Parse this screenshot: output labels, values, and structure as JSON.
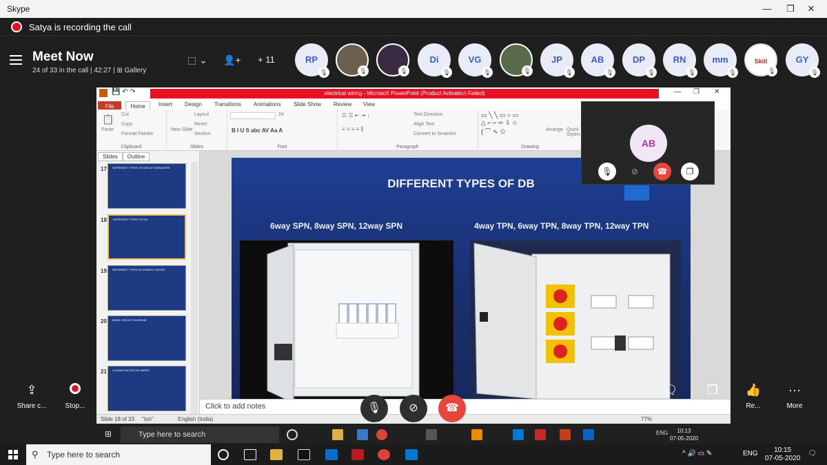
{
  "window": {
    "title": "Skype",
    "minimize": "—",
    "maximize": "❐",
    "close": "✕"
  },
  "recording": {
    "text": "Satya is recording the call"
  },
  "call": {
    "title": "Meet Now",
    "subtitle": "24 of 33 in the call | 42:27 | ⊞ Gallery",
    "more_count": "+ 11",
    "participants": [
      "RP",
      "",
      "",
      "Di",
      "VG",
      "",
      "JP",
      "AB",
      "DP",
      "RN",
      "mm",
      "Skill",
      "GY"
    ]
  },
  "ppt": {
    "title": "electrical wiring - Microsoft PowerPoint (Product Activation Failed)",
    "tabs": [
      "Home",
      "Insert",
      "Design",
      "Transitions",
      "Animations",
      "Slide Show",
      "Review",
      "View"
    ],
    "file_tab": "File",
    "ribbon": {
      "paste": "Paste",
      "cut": "Cut",
      "copy": "Copy",
      "format_painter": "Format Painter",
      "clipboard": "Clipboard",
      "new_slide": "New Slide",
      "layout": "Layout",
      "reset": "Reset",
      "section": "Section",
      "slides": "Slides",
      "font_size": "24",
      "font": "Font",
      "paragraph": "Paragraph",
      "text_direction": "Text Direction",
      "align_text": "Align Text",
      "convert_smartart": "Convert to SmartArt",
      "drawing": "Drawing",
      "arrange": "Arrange",
      "quick_styles": "Quick Styles"
    },
    "pane_tabs": [
      "Slides",
      "Outline"
    ],
    "thumbnails": [
      {
        "num": "17",
        "title": "DIFFERENT TYPES OF CIRCUIT BREAKERS"
      },
      {
        "num": "18",
        "title": "DIFFERENT TYPES OF DB"
      },
      {
        "num": "19",
        "title": "DIFFERENT TYPES OF ENERGY METER"
      },
      {
        "num": "20",
        "title": "BASIC CIRCUIT DIAGRAM"
      },
      {
        "num": "21",
        "title": "CLASSIFICATION OF WIRES"
      }
    ],
    "slide": {
      "title": "DIFFERENT TYPES OF DB",
      "left_caption": "6way SPN, 8way SPN, 12way SPN",
      "right_caption": "4way TPN, 6way TPN, 8way TPN, 12way TPN"
    },
    "notes_placeholder": "Click to add notes",
    "status": {
      "slide": "Slide 18 of 33",
      "theme": "\"Ion\"",
      "lang": "English (India)",
      "zoom": "77%"
    }
  },
  "inner_taskbar": {
    "search": "Type here to search",
    "time": "10:13",
    "date": "07-05-2020",
    "lang": "ENG"
  },
  "self_view": {
    "initials": "AB"
  },
  "side_controls": {
    "share": "Share c...",
    "stop": "Stop...",
    "chat": "Chat",
    "share2": "Shar...",
    "react": "Re...",
    "more": "More"
  },
  "taskbar": {
    "search": "Type here to search",
    "time": "10:15",
    "date": "07-05-2020",
    "lang": "ENG"
  }
}
